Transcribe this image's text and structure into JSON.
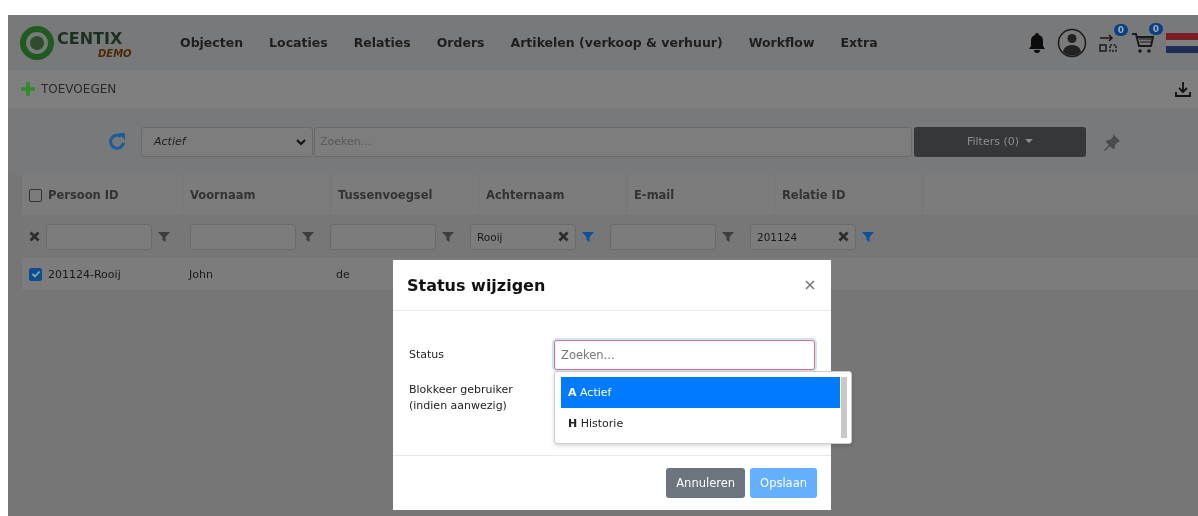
{
  "navbar": {
    "logo": {
      "name": "CENTIX",
      "tag": "DEMO"
    },
    "menu": [
      "Objecten",
      "Locaties",
      "Relaties",
      "Orders",
      "Artikelen (verkoop & verhuur)",
      "Workflow",
      "Extra"
    ],
    "transfer_badge": "0",
    "cart_badge": "0"
  },
  "toolbar": {
    "add_button": "TOEVOEGEN"
  },
  "filter_bar": {
    "status_select": "Actief",
    "search": {
      "placeholder": "Zoeken..."
    },
    "filters_button": "Filters (0)"
  },
  "table": {
    "select_all_checked": false,
    "columns": [
      "Persoon ID",
      "Voornaam",
      "Tussenvoegsel",
      "Achternaam",
      "E-mail",
      "Relatie ID"
    ],
    "filters": [
      {
        "active": false
      },
      {
        "active": false
      },
      {
        "active": false
      },
      {
        "value": "Rooij",
        "active": true
      },
      {
        "active": false
      },
      {
        "value": "201124",
        "active": true
      }
    ],
    "rows": [
      {
        "checked": true,
        "cells": [
          "201124-Rooij",
          "John",
          "de"
        ]
      }
    ]
  },
  "modal": {
    "title": "Status wijzigen",
    "status_label": "Status",
    "status_input": {
      "placeholder": "Zoeken..."
    },
    "options": [
      {
        "text": "**A** Actief",
        "selected": true
      },
      {
        "text": "**H** Historie",
        "selected": false
      }
    ],
    "block_label": "Blokkeer gebruiker (indien aanwezig)",
    "buttons": [
      {
        "label": "Annuleren",
        "kind": "secondary",
        "disabled": false
      },
      {
        "label": "Opslaan",
        "kind": "primary",
        "disabled": true
      }
    ]
  }
}
